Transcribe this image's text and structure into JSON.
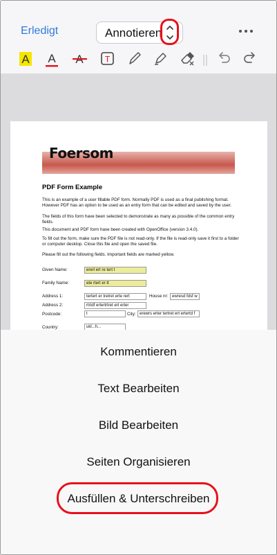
{
  "nav": {
    "done_label": "Erledigt",
    "mode_label": "Annotieren",
    "more_icon": "more-icon"
  },
  "toolbar": {
    "tools": [
      "highlight-icon",
      "underline-icon",
      "strikethrough-icon",
      "textbox-icon",
      "pencil-icon",
      "marker-icon",
      "eraser-icon",
      "undo-icon",
      "redo-icon"
    ],
    "highlight_glyph": "A",
    "underline_glyph": "A",
    "strike_glyph": "A",
    "textbox_glyph": "T"
  },
  "pdf": {
    "logo_text": "Foersom",
    "heading": "PDF Form Example",
    "paragraphs": [
      "This is an example of a user fillable PDF form. Normally PDF is used as a final publishing format. However PDF has an option to be used as an entry form that can be edited and saved by the user.",
      "The fields of this form have been selected to demonstrate as many as possible of the common entry fields.",
      "This document and PDF form have been created with OpenOffice (version 3.4.0).",
      "To fill out the form, make sure the PDF file is not read-only. If the file is read-only save it first to a folder or computer desktop. Close this file and open the saved file.",
      "Please fill out the following fields. Important fields are marked yellow."
    ],
    "labels": {
      "given_name": "Given Name:",
      "family_name": "Family Name:",
      "address1": "Address 1:",
      "house_nr": "House nr:",
      "address2": "Address 2:",
      "postcode": "Postcode:",
      "city": "City:",
      "country": "Country:"
    },
    "values": {
      "given_name": "ererl ert re tert t",
      "family_name": "ete rtert er tt",
      "address1": "tertert er tretret  erte rert",
      "house_nr": "ewresd fdsf w",
      "address2": "rtrtdf ertertrtret ert erter",
      "postcode": "t",
      "city": "erewrs erter tertret ert ertertd f",
      "country": "ukl...h..."
    },
    "colors": {
      "required_field": "#ecec9a",
      "banner": "#cf6d62"
    }
  },
  "sheet": {
    "items": [
      "Kommentieren",
      "Text Bearbeiten",
      "Bild Bearbeiten",
      "Seiten Organisieren",
      "Ausfüllen & Unterschreiben"
    ]
  },
  "colors": {
    "accent": "#2f7ad8",
    "annotation_red": "#e8101b"
  }
}
